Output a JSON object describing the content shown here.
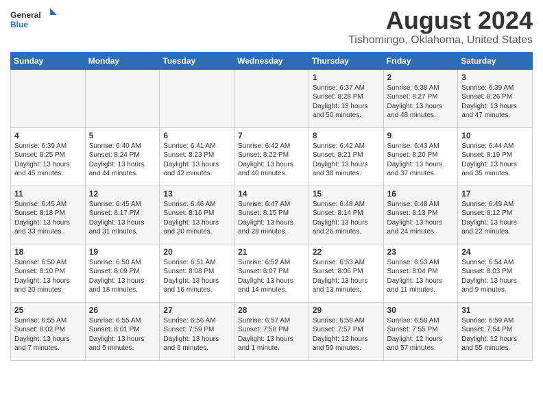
{
  "logo": {
    "line1": "General",
    "line2": "Blue"
  },
  "title": "August 2024",
  "subtitle": "Tishomingo, Oklahoma, United States",
  "days_of_week": [
    "Sunday",
    "Monday",
    "Tuesday",
    "Wednesday",
    "Thursday",
    "Friday",
    "Saturday"
  ],
  "weeks": [
    [
      {
        "day": "",
        "info": ""
      },
      {
        "day": "",
        "info": ""
      },
      {
        "day": "",
        "info": ""
      },
      {
        "day": "",
        "info": ""
      },
      {
        "day": "1",
        "info": "Sunrise: 6:37 AM\nSunset: 8:28 PM\nDaylight: 13 hours and 50 minutes."
      },
      {
        "day": "2",
        "info": "Sunrise: 6:38 AM\nSunset: 8:27 PM\nDaylight: 13 hours and 48 minutes."
      },
      {
        "day": "3",
        "info": "Sunrise: 6:39 AM\nSunset: 8:26 PM\nDaylight: 13 hours and 47 minutes."
      }
    ],
    [
      {
        "day": "4",
        "info": "Sunrise: 6:39 AM\nSunset: 8:25 PM\nDaylight: 13 hours and 45 minutes."
      },
      {
        "day": "5",
        "info": "Sunrise: 6:40 AM\nSunset: 8:24 PM\nDaylight: 13 hours and 44 minutes."
      },
      {
        "day": "6",
        "info": "Sunrise: 6:41 AM\nSunset: 8:23 PM\nDaylight: 13 hours and 42 minutes."
      },
      {
        "day": "7",
        "info": "Sunrise: 6:42 AM\nSunset: 8:22 PM\nDaylight: 13 hours and 40 minutes."
      },
      {
        "day": "8",
        "info": "Sunrise: 6:42 AM\nSunset: 8:21 PM\nDaylight: 13 hours and 38 minutes."
      },
      {
        "day": "9",
        "info": "Sunrise: 6:43 AM\nSunset: 8:20 PM\nDaylight: 13 hours and 37 minutes."
      },
      {
        "day": "10",
        "info": "Sunrise: 6:44 AM\nSunset: 8:19 PM\nDaylight: 13 hours and 35 minutes."
      }
    ],
    [
      {
        "day": "11",
        "info": "Sunrise: 6:45 AM\nSunset: 8:18 PM\nDaylight: 13 hours and 33 minutes."
      },
      {
        "day": "12",
        "info": "Sunrise: 6:45 AM\nSunset: 8:17 PM\nDaylight: 13 hours and 31 minutes."
      },
      {
        "day": "13",
        "info": "Sunrise: 6:46 AM\nSunset: 8:16 PM\nDaylight: 13 hours and 30 minutes."
      },
      {
        "day": "14",
        "info": "Sunrise: 6:47 AM\nSunset: 8:15 PM\nDaylight: 13 hours and 28 minutes."
      },
      {
        "day": "15",
        "info": "Sunrise: 6:48 AM\nSunset: 8:14 PM\nDaylight: 13 hours and 26 minutes."
      },
      {
        "day": "16",
        "info": "Sunrise: 6:48 AM\nSunset: 8:13 PM\nDaylight: 13 hours and 24 minutes."
      },
      {
        "day": "17",
        "info": "Sunrise: 6:49 AM\nSunset: 8:12 PM\nDaylight: 13 hours and 22 minutes."
      }
    ],
    [
      {
        "day": "18",
        "info": "Sunrise: 6:50 AM\nSunset: 8:10 PM\nDaylight: 13 hours and 20 minutes."
      },
      {
        "day": "19",
        "info": "Sunrise: 6:50 AM\nSunset: 8:09 PM\nDaylight: 13 hours and 18 minutes."
      },
      {
        "day": "20",
        "info": "Sunrise: 6:51 AM\nSunset: 8:08 PM\nDaylight: 13 hours and 16 minutes."
      },
      {
        "day": "21",
        "info": "Sunrise: 6:52 AM\nSunset: 8:07 PM\nDaylight: 13 hours and 14 minutes."
      },
      {
        "day": "22",
        "info": "Sunrise: 6:53 AM\nSunset: 8:06 PM\nDaylight: 13 hours and 13 minutes."
      },
      {
        "day": "23",
        "info": "Sunrise: 6:53 AM\nSunset: 8:04 PM\nDaylight: 13 hours and 11 minutes."
      },
      {
        "day": "24",
        "info": "Sunrise: 6:54 AM\nSunset: 8:03 PM\nDaylight: 13 hours and 9 minutes."
      }
    ],
    [
      {
        "day": "25",
        "info": "Sunrise: 6:55 AM\nSunset: 8:02 PM\nDaylight: 13 hours and 7 minutes."
      },
      {
        "day": "26",
        "info": "Sunrise: 6:55 AM\nSunset: 8:01 PM\nDaylight: 13 hours and 5 minutes."
      },
      {
        "day": "27",
        "info": "Sunrise: 6:56 AM\nSunset: 7:59 PM\nDaylight: 13 hours and 3 minutes."
      },
      {
        "day": "28",
        "info": "Sunrise: 6:57 AM\nSunset: 7:58 PM\nDaylight: 13 hours and 1 minute."
      },
      {
        "day": "29",
        "info": "Sunrise: 6:58 AM\nSunset: 7:57 PM\nDaylight: 12 hours and 59 minutes."
      },
      {
        "day": "30",
        "info": "Sunrise: 6:58 AM\nSunset: 7:55 PM\nDaylight: 12 hours and 57 minutes."
      },
      {
        "day": "31",
        "info": "Sunrise: 6:59 AM\nSunset: 7:54 PM\nDaylight: 12 hours and 55 minutes."
      }
    ]
  ]
}
